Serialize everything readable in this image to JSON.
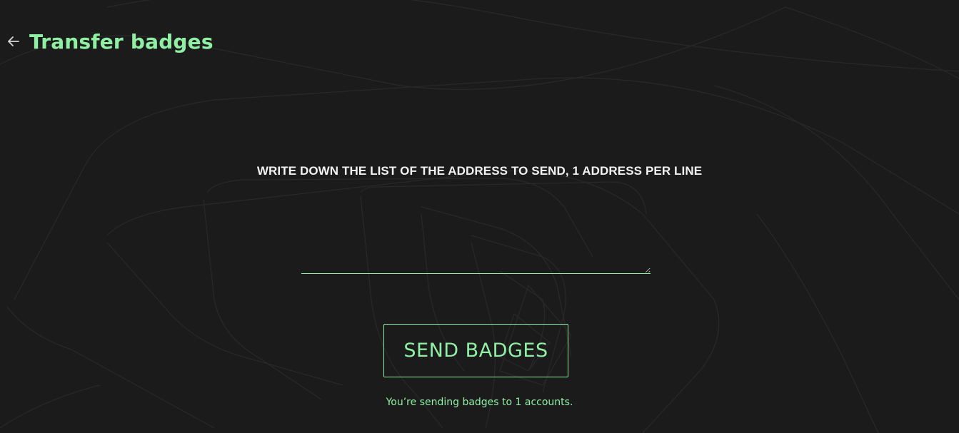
{
  "header": {
    "back_icon": "arrow-left-icon",
    "title": "Transfer badges"
  },
  "form": {
    "instruction": "WRITE DOWN THE LIST OF THE ADDRESS TO SEND, 1 ADDRESS PER LINE",
    "address_input_value": "",
    "address_input_placeholder": "",
    "send_label": "SEND BADGES",
    "status_text": "You’re sending badges to 1 accounts."
  },
  "colors": {
    "background": "#1c1b1c",
    "accent": "#8ff0a4",
    "text": "#f2f2f2"
  }
}
